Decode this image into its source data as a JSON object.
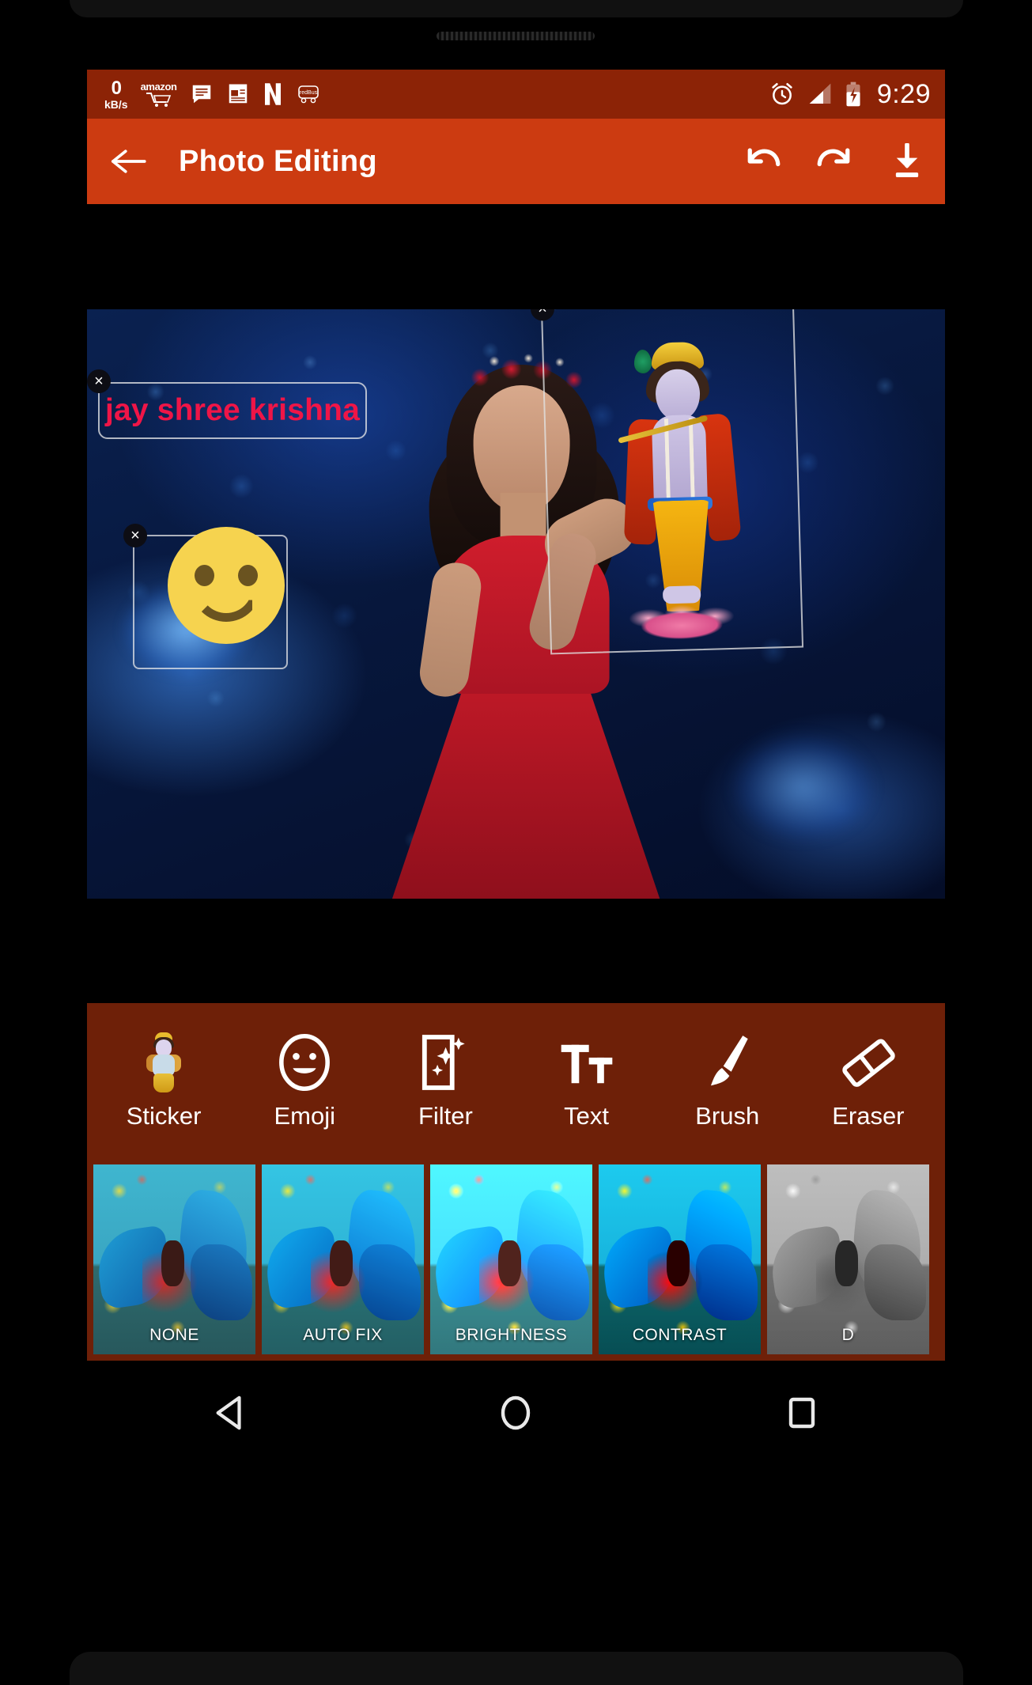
{
  "status_bar": {
    "network_speed_value": "0",
    "network_speed_unit": "kB/s",
    "amazon_label": "amazon",
    "redbus_label": "redBus",
    "netflix_label": "N",
    "time": "9:29",
    "icons": [
      "network-speed-icon",
      "amazon-icon",
      "messages-icon",
      "news-icon",
      "netflix-icon",
      "redbus-icon",
      "alarm-icon",
      "signal-icon",
      "battery-charging-icon"
    ],
    "background_color": "#8c2306"
  },
  "toolbar": {
    "title": "Photo Editing",
    "back_icon": "back-arrow-icon",
    "undo_icon": "undo-icon",
    "redo_icon": "redo-icon",
    "save_icon": "download-icon",
    "background_color": "#cc3b11"
  },
  "canvas": {
    "text_overlay": {
      "value": "jay shree krishna",
      "color": "#ef1547",
      "delete_label": "×"
    },
    "emoji_overlay": {
      "name": "smiley-face-emoji",
      "delete_label": "×"
    },
    "sticker_overlay": {
      "name": "krishna-sticker",
      "delete_label": "×"
    }
  },
  "tools": [
    {
      "label": "Sticker",
      "icon": "krishna-sticker-icon"
    },
    {
      "label": "Emoji",
      "icon": "smiley-icon"
    },
    {
      "label": "Filter",
      "icon": "filter-sparkle-icon"
    },
    {
      "label": "Text",
      "icon": "text-tt-icon"
    },
    {
      "label": "Brush",
      "icon": "brush-icon"
    },
    {
      "label": "Eraser",
      "icon": "eraser-icon"
    }
  ],
  "filters": [
    {
      "label": "NONE",
      "style": "none"
    },
    {
      "label": "AUTO FIX",
      "style": "autofix"
    },
    {
      "label": "BRIGHTNESS",
      "style": "brightness"
    },
    {
      "label": "CONTRAST",
      "style": "contrast"
    },
    {
      "label": "D",
      "style": "gray"
    }
  ],
  "nav_bar": {
    "back_icon": "nav-back-triangle-icon",
    "home_icon": "nav-home-circle-icon",
    "recents_icon": "nav-recents-square-icon"
  }
}
